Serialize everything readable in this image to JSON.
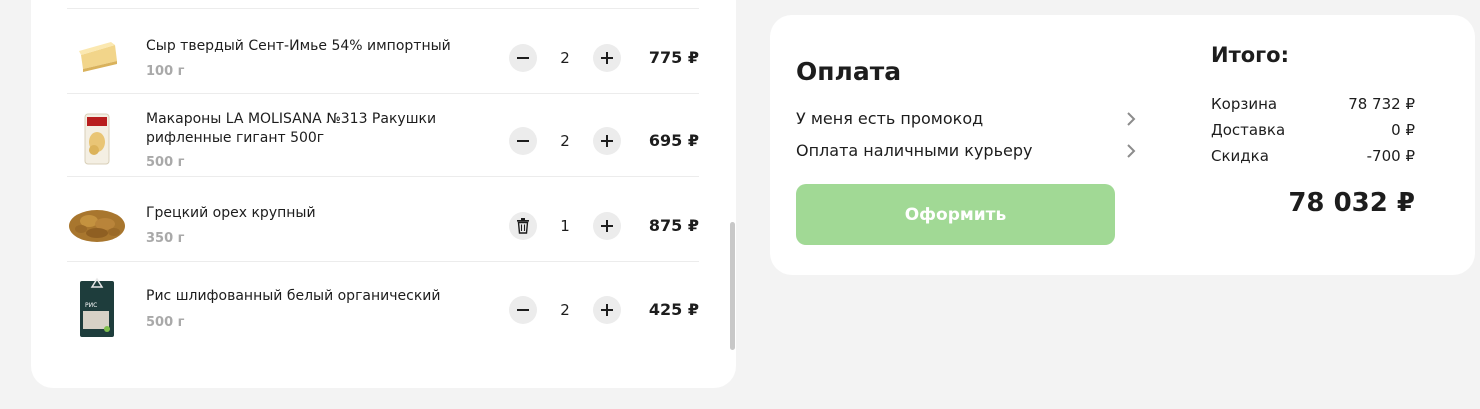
{
  "cart": {
    "items": [
      {
        "name": "Сыр твердый Сент-Имье 54% импортный",
        "weight": "100 г",
        "qty": "2",
        "price": "775 ₽",
        "control": "minus"
      },
      {
        "name": "Макароны LA MOLISANA №313 Ракушки рифленные гигант 500г",
        "weight": "500 г",
        "qty": "2",
        "price": "695 ₽",
        "control": "minus"
      },
      {
        "name": "Грецкий орех крупный",
        "weight": "350 г",
        "qty": "1",
        "price": "875 ₽",
        "control": "trash"
      },
      {
        "name": "Рис шлифованный белый органический",
        "weight": "500 г",
        "qty": "2",
        "price": "425 ₽",
        "control": "minus"
      }
    ],
    "package_label": "РИС"
  },
  "payment": {
    "title": "Оплата",
    "promo_link": "У меня есть промокод",
    "method_link": "Оплата наличными курьеру",
    "checkout_label": "Оформить"
  },
  "summary": {
    "title": "Итого:",
    "rows": [
      {
        "label": "Корзина",
        "value": "78 732 ₽"
      },
      {
        "label": "Доставка",
        "value": "0 ₽"
      },
      {
        "label": "Скидка",
        "value": "-700 ₽"
      }
    ],
    "total": "78 032 ₽"
  },
  "colors": {
    "accent": "#a1d995",
    "background": "#f3f3f3",
    "button_bg": "#ececec"
  },
  "icons": {
    "minus": "minus-icon",
    "plus": "plus-icon",
    "trash": "trash-icon",
    "chevron": "chevron-right-icon"
  }
}
